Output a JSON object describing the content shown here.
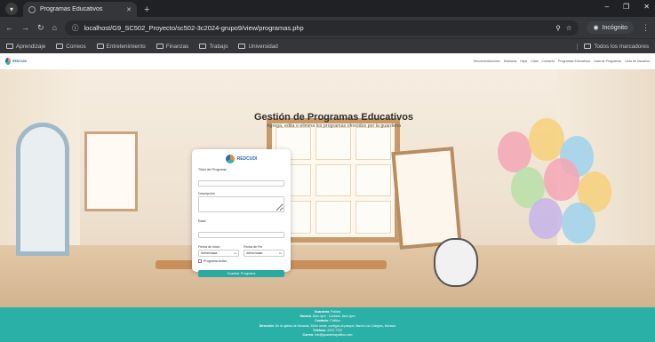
{
  "browser": {
    "tab_title": "Programas Educativos",
    "url": "localhost/G9_SC502_Proyecto/sc502-3c2024-grupo9/view/programas.php",
    "incognito_label": "Incógnito",
    "bookmarks": [
      "Aprendizaje",
      "Correos",
      "Entretenimiento",
      "Finanzas",
      "Trabajo",
      "Universidad"
    ],
    "all_bookmarks": "Todos los marcadores"
  },
  "site": {
    "brand": "REDCUDI",
    "nav": [
      "Recomendaciones",
      "Matricula",
      "Hijos",
      "Citas",
      "Contacto",
      "Programas Educativos",
      "Lista de Programas",
      "Lista de Usuarios"
    ]
  },
  "hero": {
    "title": "Gestión de Programas Educativos",
    "subtitle": "Agrega, edita o elimina los programas ofrecidos por la guardería"
  },
  "form": {
    "brand": "REDCUDI",
    "title_label": "Título del Programa",
    "description_label": "Descripción",
    "age_label": "Edad",
    "start_label": "Fecha de Inicio",
    "end_label": "Fecha de Fin",
    "date_placeholder": "dd/mm/aaaa",
    "active_label": "Programa Activo",
    "save_label": "Guardar Programa"
  },
  "footer": {
    "lines": [
      {
        "label": "Guardería",
        "value": "Pollitos"
      },
      {
        "label": "Horario",
        "value": "8am-4pm · Cuidado: 8am-4pm"
      },
      {
        "label": "Contacto",
        "value": "Pollitos"
      },
      {
        "label": "Dirección",
        "value": "De la Iglesia de Moravia, 200m oeste, contiguo al parque, Barrio Los Colegios, Moravia"
      },
      {
        "label": "Teléfono",
        "value": "2222-7722"
      },
      {
        "label": "Correo",
        "value": "info@guarderiapollitos.com"
      }
    ]
  }
}
